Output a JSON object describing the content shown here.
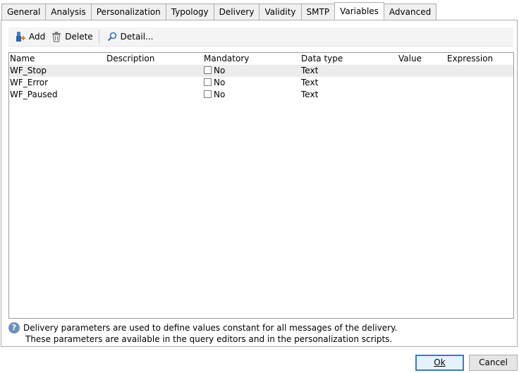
{
  "tabs": [
    "General",
    "Analysis",
    "Personalization",
    "Typology",
    "Delivery",
    "Validity",
    "SMTP",
    "Variables",
    "Advanced"
  ],
  "active_tab": "Variables",
  "toolbar": {
    "add_label": "Add",
    "delete_label": "Delete",
    "detail_label": "Detail...",
    "add_icon": "add-variable-icon",
    "delete_icon": "trash-icon",
    "detail_icon": "magnifier-icon"
  },
  "grid": {
    "columns": [
      "Name",
      "Description",
      "Mandatory",
      "Data type",
      "Value",
      "Expression"
    ],
    "rows": [
      {
        "name": "WF_Stop",
        "description": "",
        "mandatory": "No",
        "data_type": "Text",
        "value": "",
        "expression": ""
      },
      {
        "name": "WF_Error",
        "description": "",
        "mandatory": "No",
        "data_type": "Text",
        "value": "",
        "expression": ""
      },
      {
        "name": "WF_Paused",
        "description": "",
        "mandatory": "No",
        "data_type": "Text",
        "value": "",
        "expression": ""
      }
    ]
  },
  "info": {
    "icon": "question-icon",
    "line1": "Delivery parameters are used to define values constant for all messages of the delivery.",
    "line2": "These parameters are available in the query editors and in the personalization scripts."
  },
  "buttons": {
    "ok_label": "Ok",
    "cancel_label": "Cancel"
  },
  "colors": {
    "info_icon": "#6e8fb9",
    "selected_row": "#ececec",
    "primary_border": "#3c7fb1"
  }
}
